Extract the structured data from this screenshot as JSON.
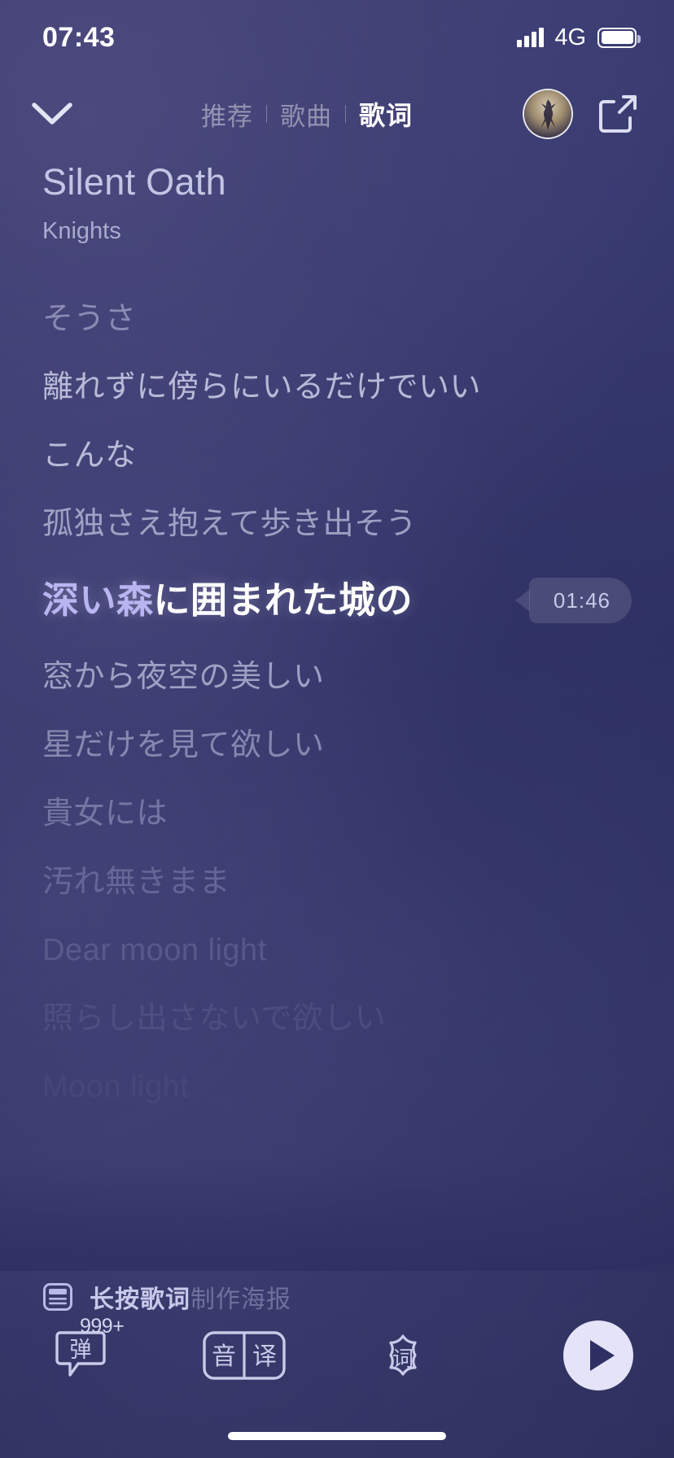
{
  "status_bar": {
    "time": "07:43",
    "network": "4G",
    "signal_icon": "signal-bars-icon",
    "battery_icon": "battery-full-icon"
  },
  "nav": {
    "collapse_icon": "chevron-down-icon",
    "tabs": [
      {
        "label": "推荐",
        "active": false
      },
      {
        "label": "歌曲",
        "active": false
      },
      {
        "label": "歌词",
        "active": true
      }
    ],
    "avatar_icon": "user-avatar-icon",
    "share_icon": "share-external-icon"
  },
  "song": {
    "title": "Silent Oath",
    "artist": "Knights"
  },
  "lyrics": {
    "current_time": "01:46",
    "lines": [
      {
        "text": "そうさ",
        "state": "past",
        "opacity": "o55"
      },
      {
        "text": "離れずに傍らにいるだけでいい",
        "state": "past",
        "opacity": "o85"
      },
      {
        "text": "こんな",
        "state": "past",
        "opacity": "o85"
      },
      {
        "text": "孤独さえ抱えて歩き出そう",
        "state": "past",
        "opacity": "o70"
      },
      {
        "text": "深い森に囲まれた城の",
        "state": "current",
        "sung": "深い森",
        "unsung": "に囲まれた城の"
      },
      {
        "text": "窓から夜空の美しい",
        "state": "upcoming",
        "opacity": "o70"
      },
      {
        "text": "星だけを見て欲しい",
        "state": "upcoming",
        "opacity": "o55"
      },
      {
        "text": "貴女には",
        "state": "upcoming",
        "opacity": "o42"
      },
      {
        "text": "汚れ無きまま",
        "state": "upcoming",
        "opacity": "o30"
      },
      {
        "text": "Dear moon light",
        "state": "upcoming",
        "opacity": "o20"
      },
      {
        "text": "照らし出さないで欲しい",
        "state": "upcoming",
        "opacity": "o12"
      },
      {
        "text": "Moon light",
        "state": "upcoming",
        "opacity": "o07"
      }
    ]
  },
  "poster_hint": {
    "icon": "poster-note-icon",
    "primary": "长按歌词",
    "secondary": "制作海报"
  },
  "toolbar": {
    "danmaku": {
      "icon": "danmaku-bubble-icon",
      "glyph": "弹",
      "count": "999+"
    },
    "translate": {
      "icon": "romaji-translate-icon",
      "left_glyph": "音",
      "right_glyph": "译"
    },
    "lyrics_source": {
      "icon": "lyrics-badge-icon",
      "glyph": "词"
    },
    "play": {
      "icon": "play-icon"
    }
  },
  "colors": {
    "background_top": "#3a3a6b",
    "background_bottom": "#2a2c58",
    "active_lyric": "#ffffff",
    "sung_highlight": "#b9b5f2",
    "accent_light": "#c8c9ea",
    "play_button_bg": "#e4e3f8"
  },
  "home_indicator": "home-indicator"
}
